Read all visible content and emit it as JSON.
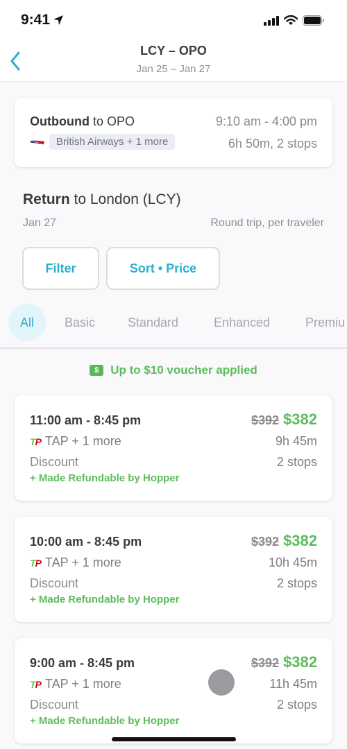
{
  "status_bar": {
    "time": "9:41",
    "icons": [
      "location-arrow-icon",
      "cellular-signal-icon",
      "wifi-icon",
      "battery-icon"
    ]
  },
  "nav": {
    "title": "LCY – OPO",
    "subtitle": "Jan 25 – Jan 27",
    "back_icon": "chevron-left-icon",
    "accent_color": "#2cb0cc"
  },
  "outbound": {
    "label_bold": "Outbound",
    "label_rest": " to OPO",
    "time": "9:10 am - 4:00 pm",
    "airline": "British Airways + 1 more",
    "airline_icon": "british-airways-logo",
    "duration": "6h 50m, 2 stops"
  },
  "return": {
    "label_bold": "Return",
    "label_rest": " to London (LCY)",
    "date": "Jan 27",
    "note": "Round trip, per traveler"
  },
  "buttons": {
    "filter": "Filter",
    "sort": "Sort • Price"
  },
  "tabs": [
    {
      "label": "All",
      "active": true
    },
    {
      "label": "Basic",
      "active": false
    },
    {
      "label": "Standard",
      "active": false
    },
    {
      "label": "Enhanced",
      "active": false
    },
    {
      "label": "Premiu",
      "active": false
    }
  ],
  "voucher": {
    "icon": "dollar-ticket-icon",
    "icon_glyph": "$",
    "text": "Up to $10 voucher applied",
    "color": "#5cbc5c"
  },
  "flights": [
    {
      "times": "11:00 am - 8:45 pm",
      "old_price": "$392",
      "price": "$382",
      "airline": "TAP + 1 more",
      "duration": "9h 45m",
      "fare_class": "Discount",
      "stops": "2 stops",
      "refund_note": "+ Made Refundable by Hopper"
    },
    {
      "times": "10:00 am - 8:45 pm",
      "old_price": "$392",
      "price": "$382",
      "airline": "TAP + 1 more",
      "duration": "10h 45m",
      "fare_class": "Discount",
      "stops": "2 stops",
      "refund_note": "+ Made Refundable by Hopper"
    },
    {
      "times": "9:00 am - 8:45 pm",
      "old_price": "$392",
      "price": "$382",
      "airline": "TAP + 1 more",
      "duration": "11h 45m",
      "fare_class": "Discount",
      "stops": "2 stops",
      "refund_note": "+ Made Refundable by Hopper"
    }
  ],
  "tap_logo": {
    "t": "T",
    "p": "P"
  }
}
